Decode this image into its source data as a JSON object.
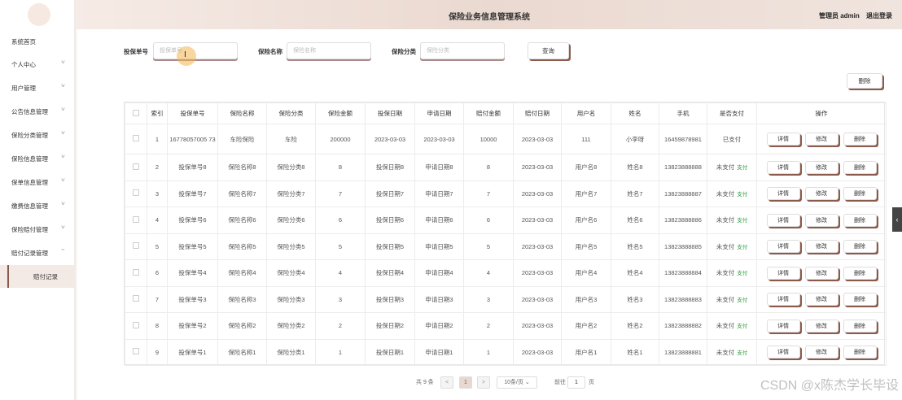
{
  "header": {
    "title": "保险业务信息管理系统",
    "user": "管理员 admin",
    "logout": "退出登录"
  },
  "sidebar": {
    "items": [
      {
        "label": "系统首页"
      },
      {
        "label": "个人中心"
      },
      {
        "label": "用户管理"
      },
      {
        "label": "公告信息管理"
      },
      {
        "label": "保险分类管理"
      },
      {
        "label": "保险信息管理"
      },
      {
        "label": "保单信息管理"
      },
      {
        "label": "缴费信息管理"
      },
      {
        "label": "保险赔付管理"
      },
      {
        "label": "赔付记录管理"
      }
    ],
    "sub": "赔付记录"
  },
  "search": {
    "f1_label": "投保单号",
    "f1_ph": "投保单号",
    "f2_label": "保险名称",
    "f2_ph": "保险名称",
    "f3_label": "保险分类",
    "f3_ph": "保险分类",
    "query": "查询"
  },
  "delete_btn": "删除",
  "table": {
    "headers": [
      "",
      "索引",
      "投保单号",
      "保险名称",
      "保险分类",
      "保险金额",
      "投保日期",
      "申请日期",
      "赔付金额",
      "赔付日期",
      "用户名",
      "姓名",
      "手机",
      "是否支付",
      "操作"
    ],
    "rows": [
      [
        "1",
        "16778057005 73",
        "车险保险",
        "车险",
        "200000",
        "2023-03-03",
        "2023-03-03",
        "10000",
        "2023-03-03",
        "111",
        "小李呀",
        "16459878981",
        "已支付",
        ""
      ],
      [
        "2",
        "投保单号8",
        "保险名称8",
        "保险分类8",
        "8",
        "投保日期8",
        "申请日期8",
        "8",
        "2023-03-03",
        "用户名8",
        "姓名8",
        "13823888888",
        "未支付",
        "支付"
      ],
      [
        "3",
        "投保单号7",
        "保险名称7",
        "保险分类7",
        "7",
        "投保日期7",
        "申请日期7",
        "7",
        "2023-03-03",
        "用户名7",
        "姓名7",
        "13823888887",
        "未支付",
        "支付"
      ],
      [
        "4",
        "投保单号6",
        "保险名称6",
        "保险分类6",
        "6",
        "投保日期6",
        "申请日期6",
        "6",
        "2023-03-03",
        "用户名6",
        "姓名6",
        "13823888886",
        "未支付",
        "支付"
      ],
      [
        "5",
        "投保单号5",
        "保险名称5",
        "保险分类5",
        "5",
        "投保日期5",
        "申请日期5",
        "5",
        "2023-03-03",
        "用户名5",
        "姓名5",
        "13823888885",
        "未支付",
        "支付"
      ],
      [
        "6",
        "投保单号4",
        "保险名称4",
        "保险分类4",
        "4",
        "投保日期4",
        "申请日期4",
        "4",
        "2023-03-03",
        "用户名4",
        "姓名4",
        "13823888884",
        "未支付",
        "支付"
      ],
      [
        "7",
        "投保单号3",
        "保险名称3",
        "保险分类3",
        "3",
        "投保日期3",
        "申请日期3",
        "3",
        "2023-03-03",
        "用户名3",
        "姓名3",
        "13823888883",
        "未支付",
        "支付"
      ],
      [
        "8",
        "投保单号2",
        "保险名称2",
        "保险分类2",
        "2",
        "投保日期2",
        "申请日期2",
        "2",
        "2023-03-03",
        "用户名2",
        "姓名2",
        "13823888882",
        "未支付",
        "支付"
      ],
      [
        "9",
        "投保单号1",
        "保险名称1",
        "保险分类1",
        "1",
        "投保日期1",
        "申请日期1",
        "1",
        "2023-03-03",
        "用户名1",
        "姓名1",
        "13823888881",
        "未支付",
        "支付"
      ]
    ],
    "actions": [
      "详情",
      "修改",
      "删除"
    ]
  },
  "pager": {
    "total": "共 9 条",
    "page": "1",
    "size": "10条/页",
    "goto": "前往",
    "goto_val": "1",
    "unit": "页",
    "prev": "<",
    "next": ">"
  },
  "watermark": "CSDN @x陈杰学长毕设",
  "icons": {
    "chevron": "chevron-down-icon",
    "chevron_up": "chevron-up-icon",
    "cursor": "text-cursor-icon"
  },
  "colors": {
    "accent": "#8c5a4c",
    "pay": "#2a9d3a"
  }
}
